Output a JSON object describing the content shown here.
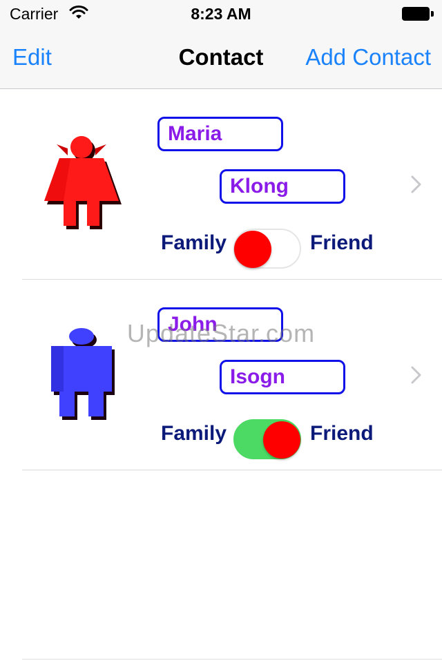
{
  "status_bar": {
    "carrier": "Carrier",
    "time": "8:23 AM",
    "wifi_icon": "wifi-icon",
    "battery_icon": "battery-icon"
  },
  "nav": {
    "left_button": "Edit",
    "title": "Contact",
    "right_button": "Add Contact",
    "accent": "#1a82fb"
  },
  "contacts": [
    {
      "first_name": "Maria",
      "last_name": "Klong",
      "avatar_icon": "female-person-icon",
      "avatar_color": "#ff0000",
      "family_label": "Family",
      "friend_label": "Friend",
      "toggle_on": false
    },
    {
      "first_name": "John",
      "last_name": "Isogn",
      "avatar_icon": "male-person-icon",
      "avatar_color": "#3b3bf0",
      "family_label": "Family",
      "friend_label": "Friend",
      "toggle_on": true
    }
  ],
  "watermark": "UpdateStar.com"
}
